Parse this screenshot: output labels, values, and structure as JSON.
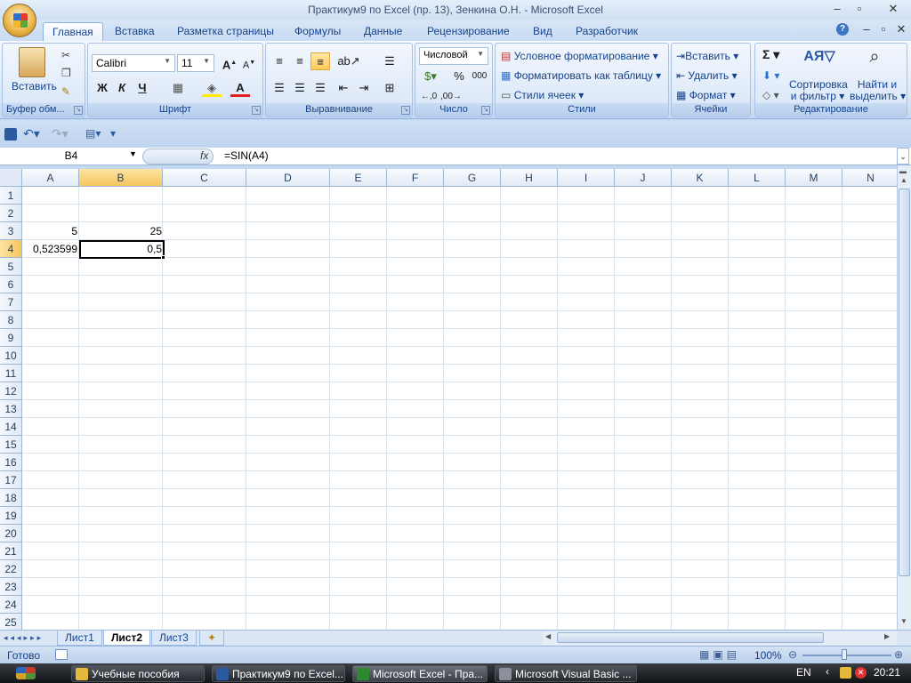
{
  "window": {
    "title": "Практикум9 по Excel (пр. 13), Зенкина О.Н. - Microsoft Excel"
  },
  "tabs": [
    "Главная",
    "Вставка",
    "Разметка страницы",
    "Формулы",
    "Данные",
    "Рецензирование",
    "Вид",
    "Разработчик"
  ],
  "ribbon": {
    "clipboard": {
      "paste": "Вставить",
      "label": "Буфер обм..."
    },
    "font": {
      "name": "Calibri",
      "size": "11",
      "bold": "Ж",
      "italic": "К",
      "underline": "Ч",
      "label": "Шрифт"
    },
    "alignment": {
      "label": "Выравнивание"
    },
    "number": {
      "format": "Числовой",
      "percent": "%",
      "thousands": "000",
      "label": "Число"
    },
    "styles": {
      "conditional": "Условное форматирование",
      "as_table": "Форматировать как таблицу",
      "cell_styles": "Стили ячеек",
      "label": "Стили"
    },
    "cells": {
      "insert": "Вставить",
      "delete": "Удалить",
      "format": "Формат",
      "label": "Ячейки"
    },
    "editing": {
      "sort_1": "Сортировка",
      "sort_2": "и фильтр",
      "find_1": "Найти и",
      "find_2": "выделить",
      "label": "Редактирование"
    }
  },
  "formula_bar": {
    "name_box": "B4",
    "fx": "fx",
    "formula": "=SIN(A4)"
  },
  "grid": {
    "columns": [
      "A",
      "B",
      "C",
      "D",
      "E",
      "F",
      "G",
      "H",
      "I",
      "J",
      "K",
      "L",
      "M",
      "N"
    ],
    "rows": [
      "1",
      "2",
      "3",
      "4",
      "5",
      "6",
      "7",
      "8",
      "9",
      "10",
      "11",
      "12",
      "13",
      "14",
      "15",
      "16",
      "17",
      "18",
      "19",
      "20",
      "21",
      "22",
      "23",
      "24",
      "25"
    ],
    "cells": {
      "A3": "5",
      "B3": "25",
      "A4": "0,523599",
      "B4": "0,5"
    }
  },
  "sheets": [
    "Лист1",
    "Лист2",
    "Лист3"
  ],
  "status": {
    "ready": "Готово",
    "zoom": "100%"
  },
  "taskbar": {
    "items": [
      "Учебные пособия",
      "Практикум9 по Excel...",
      "Microsoft Excel - Пра...",
      "Microsoft Visual Basic ..."
    ],
    "lang": "EN",
    "time": "20:21"
  },
  "colors": {
    "accent": "#15428b",
    "selection": "#f7c55d",
    "ribbon_bg": "#dbe8f7"
  }
}
